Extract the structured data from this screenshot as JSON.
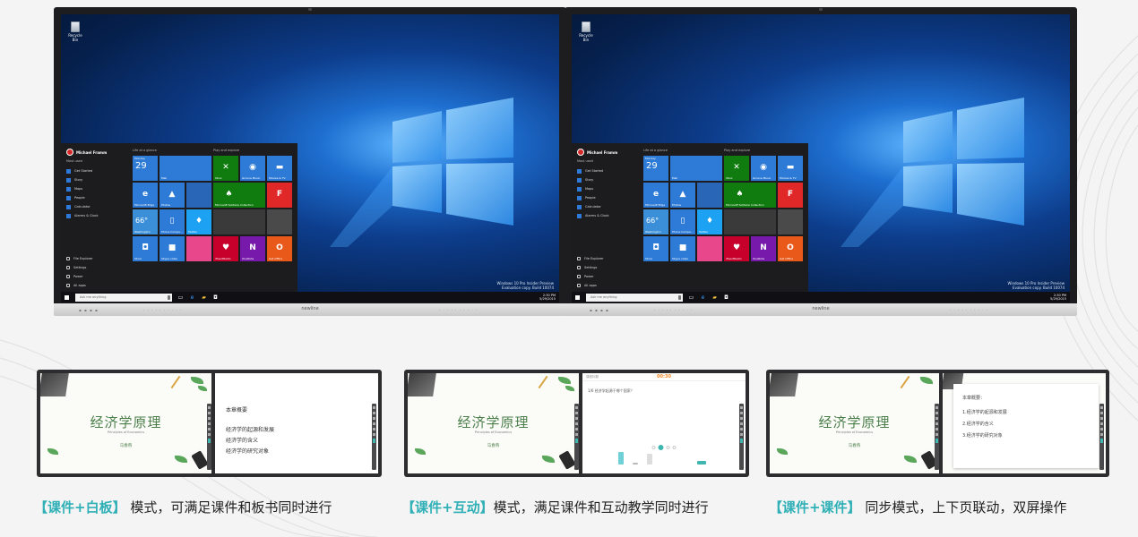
{
  "colors": {
    "accent": "#2fb0b6",
    "slide_green": "#4b7f4a",
    "timer_orange": "#f28a2d"
  },
  "desktop": {
    "recycle_label": "Recycle Bin",
    "watermark_lines": [
      "Windows 10 Pro Insider Preview",
      "Evaluation copy. Build 10074"
    ],
    "brand": "newline"
  },
  "start_menu": {
    "user": "Michael Framm",
    "most_used_label": "Most used",
    "apps": [
      "Get Started",
      "Story",
      "Maps",
      "People",
      "Calculator",
      "Alarms & Clock"
    ],
    "system": [
      "File Explorer",
      "Settings",
      "Power",
      "All apps"
    ],
    "life_label": "Life at a glance",
    "play_label": "Play and explore",
    "tiles": {
      "calendar_day": "29",
      "calendar_label": "Monday",
      "mail_label": "Mail",
      "weather_temp": "66°",
      "weather_label": "Washington",
      "edge_label": "Microsoft Edge",
      "photos_label": "Photos",
      "twitter_label": "Twitter",
      "phone_label": "Phone Compa...",
      "store_label": "Store",
      "skype_label": "Skype video",
      "xbox_label": "Xbox",
      "groove_label": "Groove Music",
      "movies_label": "Movies & TV",
      "solitaire_label": "Microsoft Solitaire Collection",
      "flipboard_label": "Flipboard",
      "onenote_label": "OneNote",
      "office_label": "Get Office",
      "iheart_label": "iHeartRadio"
    }
  },
  "taskbar": {
    "search_placeholder": "Ask me anything",
    "time": "2:30 PM",
    "date": "5/29/2015"
  },
  "panels": {
    "slide_title": "经济学原理",
    "slide_subtitle": "Principles of Economics",
    "slide_author": "马春燕",
    "whiteboard_lines": [
      "本章概要",
      "经济学的起源和发展",
      "经济学的含义",
      "经济学的研究对象"
    ],
    "interactive_header": "课程标题",
    "interactive_timer": "00:30",
    "interactive_question": "1/6  经济学起源于哪个国家？",
    "outline_title": "本章概要：",
    "outline_items": [
      "1.经济学的起源和发展",
      "2.经济学的含义",
      "3.经济学的研究对象"
    ]
  },
  "captions": [
    {
      "highlight": "【课件+白板】",
      "text": " 模式，可满足课件和板书同时进行"
    },
    {
      "highlight": "【课件+互动】",
      "text": "模式，满足课件和互动教学同时进行"
    },
    {
      "highlight": "【课件+课件】",
      "text": " 同步模式，上下页联动，双屏操作"
    }
  ]
}
